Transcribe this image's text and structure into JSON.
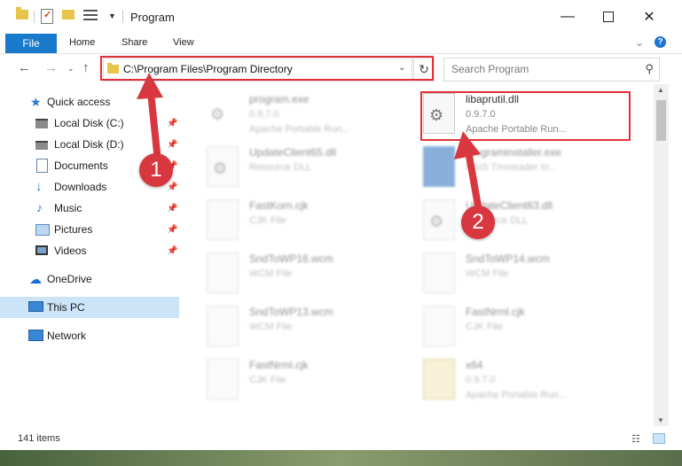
{
  "titlebar": {
    "title": "Program",
    "minimize_icon": "minimize-icon",
    "maximize_icon": "maximize-icon",
    "close_icon": "close-icon"
  },
  "ribbon": {
    "file": "File",
    "home": "Home",
    "share": "Share",
    "view": "View"
  },
  "nav": {
    "address": "C:\\Program Files\\Program Directory",
    "search_placeholder": "Search Program"
  },
  "sidebar": {
    "items": [
      {
        "label": "Quick access",
        "icon": "star-icon",
        "pinned": false
      },
      {
        "label": "Local Disk (C:)",
        "icon": "disk-icon",
        "pinned": true
      },
      {
        "label": "Local Disk (D:)",
        "icon": "disk-icon",
        "pinned": true
      },
      {
        "label": "Documents",
        "icon": "documents-icon",
        "pinned": true
      },
      {
        "label": "Downloads",
        "icon": "download-icon",
        "pinned": true
      },
      {
        "label": "Music",
        "icon": "music-icon",
        "pinned": true
      },
      {
        "label": "Pictures",
        "icon": "pictures-icon",
        "pinned": true
      },
      {
        "label": "Videos",
        "icon": "videos-icon",
        "pinned": true
      },
      {
        "label": "OneDrive",
        "icon": "cloud-icon",
        "pinned": false
      },
      {
        "label": "This PC",
        "icon": "computer-icon",
        "pinned": false,
        "selected": true
      },
      {
        "label": "Network",
        "icon": "network-icon",
        "pinned": false
      }
    ]
  },
  "files": [
    {
      "name": "program.exe",
      "line2": "0.9.7.0",
      "line3": "Apache Portable Run...",
      "blurred": true
    },
    {
      "name": "libaprutil.dll",
      "line2": "0.9.7.0",
      "line3": "Apache Portable Run...",
      "blurred": false,
      "highlighted": true
    },
    {
      "name": "UpdateClient65.dll",
      "line2": "Resource DLL",
      "line3": "",
      "blurred": true
    },
    {
      "name": "programinstaller.exe",
      "line2": "NSIS Tmmeader In...",
      "line3": "",
      "blurred": true
    },
    {
      "name": "FastKorn.cjk",
      "line2": "CJK File",
      "line3": "",
      "blurred": true
    },
    {
      "name": "UpdateClient63.dll",
      "line2": "Resource DLL",
      "line3": "",
      "blurred": true
    },
    {
      "name": "SndToWP16.wcm",
      "line2": "WCM File",
      "line3": "",
      "blurred": true
    },
    {
      "name": "SndToWP14.wcm",
      "line2": "WCM File",
      "line3": "",
      "blurred": true
    },
    {
      "name": "SndToWP13.wcm",
      "line2": "WCM File",
      "line3": "",
      "blurred": true
    },
    {
      "name": "FastNrml.cjk",
      "line2": "CJK File",
      "line3": "",
      "blurred": true
    },
    {
      "name": "FastNrml.cjk",
      "line2": "CJK File",
      "line3": "",
      "blurred": true
    },
    {
      "name": "x64",
      "line2": "0.9.7.0",
      "line3": "Apache Portable Run...",
      "blurred": true
    }
  ],
  "status": {
    "items_count": "141 items"
  },
  "annotations": {
    "step1": "1",
    "step2": "2",
    "highlight_color": "#e0303a"
  }
}
